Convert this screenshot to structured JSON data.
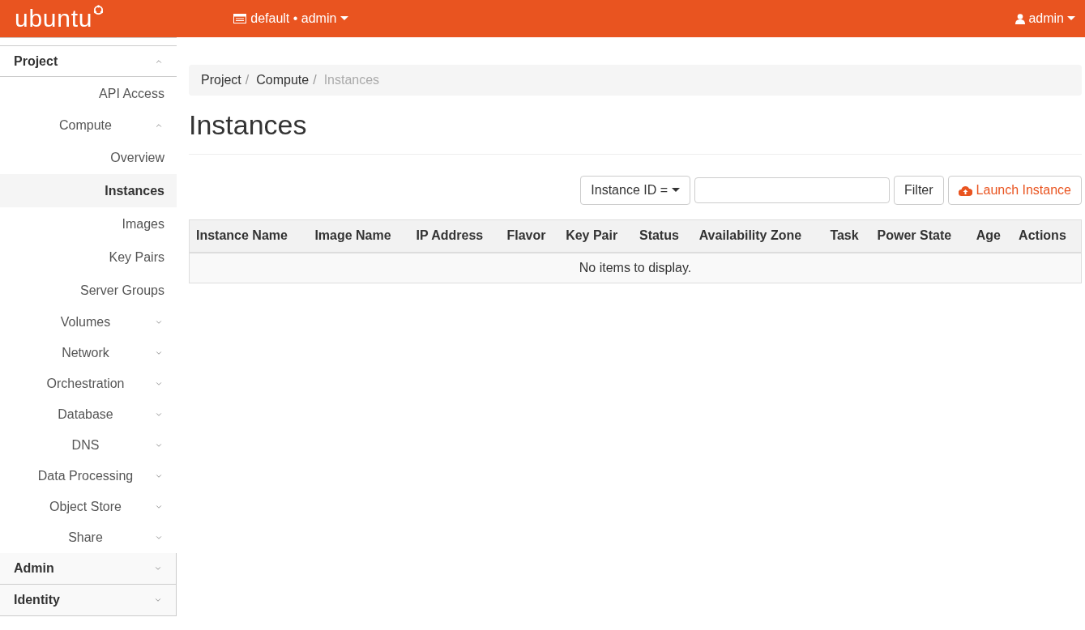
{
  "topbar": {
    "logo": "ubuntu",
    "project_menu": "default • admin",
    "user_menu": "admin"
  },
  "sidebar": {
    "sections": [
      {
        "label": "Project",
        "expanded": true,
        "items": [
          {
            "kind": "link",
            "label": "API Access",
            "selected": false
          },
          {
            "kind": "group",
            "label": "Compute",
            "expanded": true,
            "children": [
              {
                "label": "Overview",
                "selected": false
              },
              {
                "label": "Instances",
                "selected": true
              },
              {
                "label": "Images",
                "selected": false
              },
              {
                "label": "Key Pairs",
                "selected": false
              },
              {
                "label": "Server Groups",
                "selected": false
              }
            ]
          },
          {
            "kind": "group",
            "label": "Volumes",
            "expanded": false
          },
          {
            "kind": "group",
            "label": "Network",
            "expanded": false
          },
          {
            "kind": "group",
            "label": "Orchestration",
            "expanded": false
          },
          {
            "kind": "group",
            "label": "Database",
            "expanded": false
          },
          {
            "kind": "group",
            "label": "DNS",
            "expanded": false
          },
          {
            "kind": "group",
            "label": "Data Processing",
            "expanded": false
          },
          {
            "kind": "group",
            "label": "Object Store",
            "expanded": false
          },
          {
            "kind": "group",
            "label": "Share",
            "expanded": false
          }
        ]
      },
      {
        "label": "Admin",
        "expanded": false
      },
      {
        "label": "Identity",
        "expanded": false
      }
    ]
  },
  "breadcrumb": [
    {
      "label": "Project",
      "current": false
    },
    {
      "separator": "/",
      "label": "Compute",
      "current": false
    },
    {
      "separator": "/",
      "label": "Instances",
      "current": true
    }
  ],
  "page_title": "Instances",
  "toolbar": {
    "filter_field": "Instance ID =",
    "filter_button": "Filter",
    "launch_button": "Launch Instance"
  },
  "table": {
    "columns": [
      "Instance Name",
      "Image Name",
      "IP Address",
      "Flavor",
      "Key Pair",
      "Status",
      "Availability Zone",
      "Task",
      "Power State",
      "Age",
      "Actions"
    ],
    "empty_message": "No items to display."
  }
}
